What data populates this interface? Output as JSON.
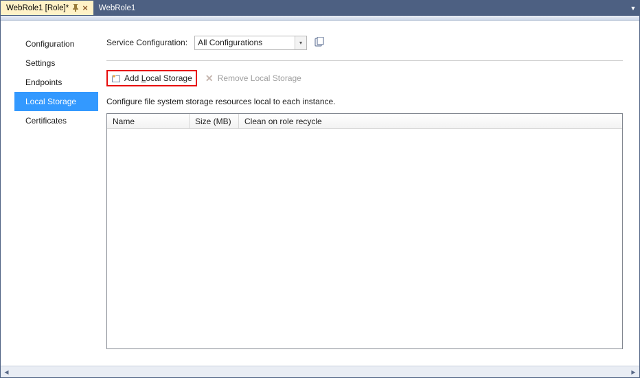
{
  "tabs": {
    "active": {
      "label": "WebRole1 [Role]*"
    },
    "inactive": {
      "label": "WebRole1"
    }
  },
  "sidebar": {
    "items": [
      {
        "label": "Configuration"
      },
      {
        "label": "Settings"
      },
      {
        "label": "Endpoints"
      },
      {
        "label": "Local Storage"
      },
      {
        "label": "Certificates"
      }
    ],
    "selected_index": 3
  },
  "service_config": {
    "label": "Service Configuration:",
    "selected": "All Configurations"
  },
  "toolbar": {
    "add": {
      "prefix": "Add ",
      "accel": "L",
      "suffix": "ocal Storage"
    },
    "remove": {
      "label": "Remove Local Storage"
    }
  },
  "hint": "Configure file system storage resources local to each instance.",
  "table": {
    "columns": [
      {
        "label": "Name"
      },
      {
        "label": "Size (MB)"
      },
      {
        "label": "Clean on role recycle"
      }
    ]
  }
}
